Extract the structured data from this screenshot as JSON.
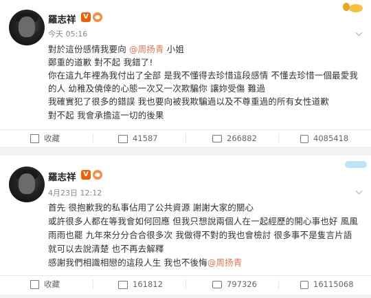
{
  "posts": [
    {
      "author": "羅志祥",
      "verified_badge": "V",
      "time": "今天 05:16",
      "lines": [
        {
          "text": "對於這份感情我要向 ",
          "mention": "周扬青",
          "after": " 小姐"
        },
        {
          "text": "鄭重的道歉 對不起 我錯了!"
        },
        {
          "text": "你在這九年裡為我付出了全部 是我不懂得去珍惜這段感情 不懂去珍惜一個最愛我"
        },
        {
          "text": "的人 幼稚及僥倖的心態一次又一次欺騙你 讓妳受傷 難過"
        },
        {
          "text": "我確實犯了很多的錯誤 我也要向被我欺騙過以及不尊重過的所有女性道歉"
        },
        {
          "text": "對不起   我會承擔這一切的後果"
        }
      ],
      "actions": {
        "favorite": "收藏",
        "share": "41587",
        "comment": "266882",
        "like": "4085418"
      }
    },
    {
      "author": "羅志祥",
      "verified_badge": "V",
      "time": "4月23日 12:12",
      "lines": [
        {
          "text": "首先 很抱歉我的私事佔用了公共資源 謝謝大家的關心"
        },
        {
          "text": "或許很多人都在等我會如何回應 但我只想說兩個人在一起經歷的開心事也好 風風"
        },
        {
          "text": "雨雨也罷 九年來分分合合很多次 我做得不對的我也會檢討 很多事不是隻言片語"
        },
        {
          "text": "就可以去說清楚 也不再去解釋"
        },
        {
          "text": "感謝我們相識相戀的這段人生 我也不後悔",
          "mention": "周扬青"
        }
      ],
      "actions": {
        "favorite": "收藏",
        "share": "161812",
        "comment": "797326",
        "like": "16115068"
      }
    }
  ],
  "icons": [
    "favorite-icon",
    "share-icon",
    "comment-icon",
    "like-icon",
    "verified-icon",
    "level-icon",
    "more-chevron-icon"
  ],
  "colors": {
    "mention": "#eb7350",
    "verified": "#f25d00",
    "background": "#f2f2f2"
  }
}
